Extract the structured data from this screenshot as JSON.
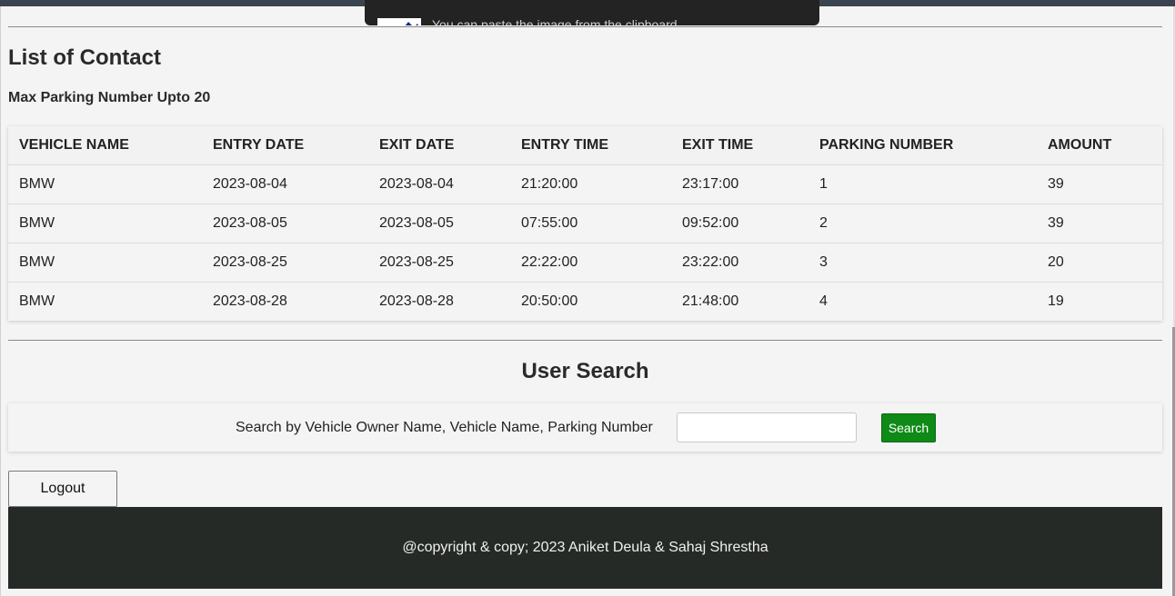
{
  "notification": {
    "text": "You can paste the image from the clipboard."
  },
  "contacts": {
    "title": "List of Contact",
    "subtitle": "Max Parking Number Upto 20",
    "columns": [
      "VEHICLE NAME",
      "ENTRY DATE",
      "EXIT DATE",
      "ENTRY TIME",
      "EXIT TIME",
      "PARKING NUMBER",
      "AMOUNT"
    ],
    "rows": [
      [
        "BMW",
        "2023-08-04",
        "2023-08-04",
        "21:20:00",
        "23:17:00",
        "1",
        "39"
      ],
      [
        "BMW",
        "2023-08-05",
        "2023-08-05",
        "07:55:00",
        "09:52:00",
        "2",
        "39"
      ],
      [
        "BMW",
        "2023-08-25",
        "2023-08-25",
        "22:22:00",
        "23:22:00",
        "3",
        "20"
      ],
      [
        "BMW",
        "2023-08-28",
        "2023-08-28",
        "20:50:00",
        "21:48:00",
        "4",
        "19"
      ]
    ]
  },
  "search": {
    "title": "User Search",
    "label": "Search by Vehicle Owner Name, Vehicle Name, Parking Number",
    "input_value": "",
    "button_label": "Search"
  },
  "logout_label": "Logout",
  "footer": {
    "text": "@copyright & copy; 2023 Aniket Deula & Sahaj Shrestha"
  },
  "colors": {
    "page_background": "#f4f4f4",
    "footer_background": "#262a27",
    "search_button": "#0f8a17",
    "topbar": "#3a4450"
  }
}
